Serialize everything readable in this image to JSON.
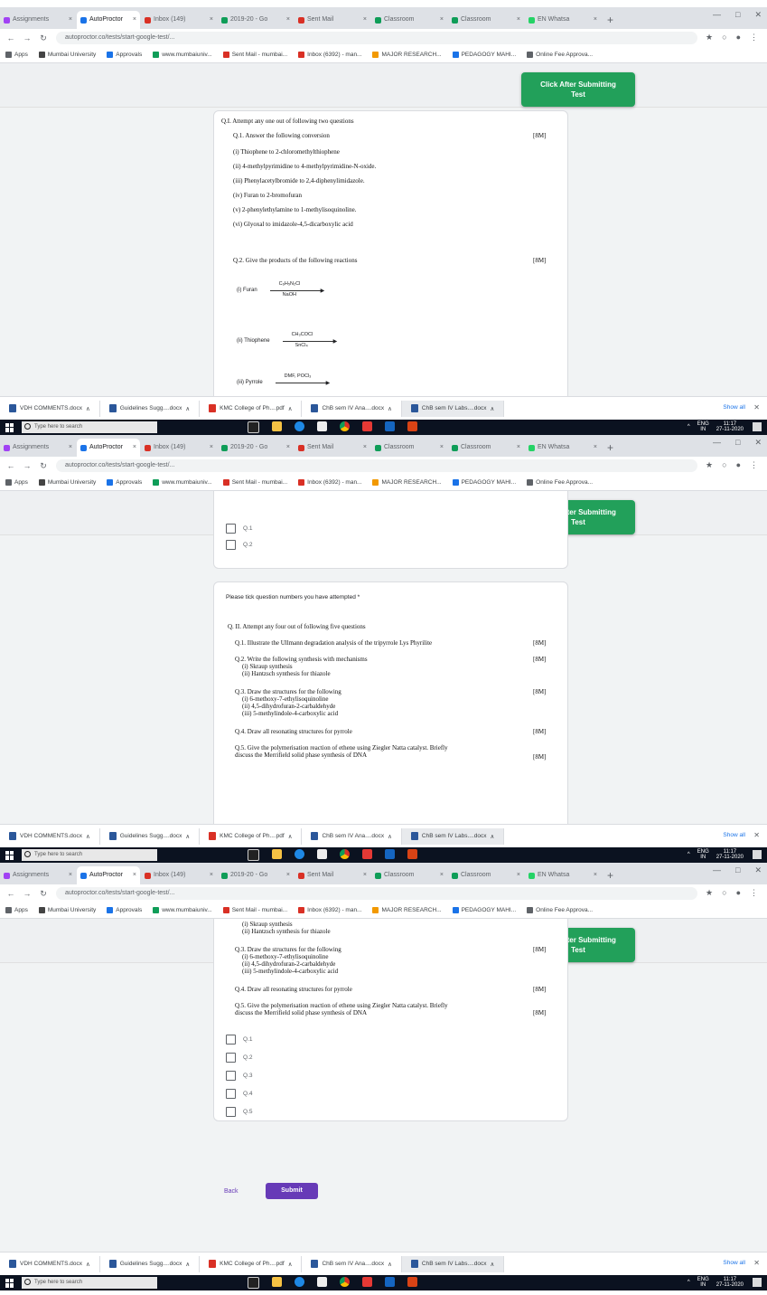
{
  "caption": "...",
  "browser": {
    "tabs": [
      {
        "label": "Assignments",
        "color": "#a142f4"
      },
      {
        "label": "AutoProctor",
        "color": "#1a73e8",
        "active": true
      },
      {
        "label": "Inbox (149)",
        "color": "#d93025"
      },
      {
        "label": "2019-20 - Go",
        "color": "#0f9d58"
      },
      {
        "label": "Sent Mail",
        "color": "#d93025"
      },
      {
        "label": "Classroom",
        "color": "#0f9d58"
      },
      {
        "label": "Classroom",
        "color": "#0f9d58"
      },
      {
        "label": "EN Whatsa",
        "color": "#25d366"
      }
    ],
    "url": "autoproctor.co/tests/start-google-test/...",
    "bookmarks": [
      {
        "label": "Apps",
        "color": "#5f6368"
      },
      {
        "label": "Mumbai University",
        "color": "#444"
      },
      {
        "label": "Approvals",
        "color": "#1a73e8"
      },
      {
        "label": "www.mumbaiuniv...",
        "color": "#0f9d58"
      },
      {
        "label": "Sent Mail - mumbai...",
        "color": "#d93025"
      },
      {
        "label": "Inbox (6392) - man...",
        "color": "#d93025"
      },
      {
        "label": "MAJOR RESEARCH...",
        "color": "#f29900"
      },
      {
        "label": "PEDAGOGY MAHI...",
        "color": "#1a73e8"
      },
      {
        "label": "Online Fee Approva...",
        "color": "#5f6368"
      }
    ]
  },
  "green_button": {
    "line1": "Click After Submitting",
    "line2": "Test"
  },
  "downloads": [
    {
      "label": "VDH COMMENTS.docx",
      "type": "doc"
    },
    {
      "label": "Guidelines Sugg....docx",
      "type": "doc"
    },
    {
      "label": "KMC College of Ph....pdf",
      "type": "pdf"
    },
    {
      "label": "ChB sem IV Ana....docx",
      "type": "doc"
    },
    {
      "label": "ChB sem IV Labs....docx",
      "type": "doc"
    }
  ],
  "show_all": "Show all",
  "taskbar": {
    "search": "Type here to search",
    "lang": "ENG",
    "region": "IN",
    "time": "11:17",
    "date": "27-11-2020"
  },
  "section1": {
    "heading": "Q.I. Attempt any one out of following two questions",
    "q1": "Q.1. Answer the following conversion",
    "q1_marks": "[8M]",
    "items": [
      "(i) Thiophene to 2-chloromethylthiophene",
      "(ii) 4-methylpyrimidine to 4-methylpyrimidine-N-oxide.",
      "(iii) Phenylacetylbromide to 2,4-diphenylimidazole.",
      "(iv) Furan to 2-bromofuran",
      "(v) 2-phenylethylamine to 1-methylisoquinoline.",
      "(vi) Glyoxal to imidazole-4,5-dicarboxylic acid"
    ],
    "q2": "Q.2. Give the products of the following reactions",
    "q2_marks": "[8M]",
    "reactions": [
      {
        "label": "(i) Furan",
        "top": "C₆H₅N₂Cl",
        "bottom": "NaOH"
      },
      {
        "label": "(ii) Thiophene",
        "top": "CH₃COCl",
        "bottom": "SnCl₄"
      },
      {
        "label": "(iii) Pyrrole",
        "top": "DMF, POCl₃",
        "bottom": ""
      }
    ]
  },
  "section2": {
    "options_a": [
      "Q.1",
      "Q.2"
    ],
    "prompt": "Please tick question numbers you have attempted *",
    "heading": "Q. II. Attempt any four out of following five questions",
    "q1": "Q.1. Illustrate the Ullmann degradation analysis of the tripyrrole Lys Phyrilite",
    "q2": "Q.2. Write the following synthesis with mechanisms",
    "q2a": "(i) Skraup synthesis",
    "q2b": "(ii) Hantzsch synthesis for thiazole",
    "q3": "Q.3. Draw the structures for the following",
    "q3a": "(i) 6-methoxy-7-ethylisoquinoline",
    "q3b": "(ii) 4,5-dihydrofuran-2-carbaldehyde",
    "q3c": "(iii) 5-methylindole-4-carboxylic acid",
    "q4": "Q.4. Draw all resonating structures for pyrrole",
    "q5a": "Q.5. Give the polymerisation reaction of ethene using Ziegler Natta catalyst. Briefly",
    "q5b": "discuss the Merrifield solid phase synthesis of DNA",
    "marks": "[8M]"
  },
  "section3": {
    "options": [
      "Q.1",
      "Q.2",
      "Q.3",
      "Q.4",
      "Q.5"
    ],
    "back": "Back",
    "submit": "Submit"
  }
}
